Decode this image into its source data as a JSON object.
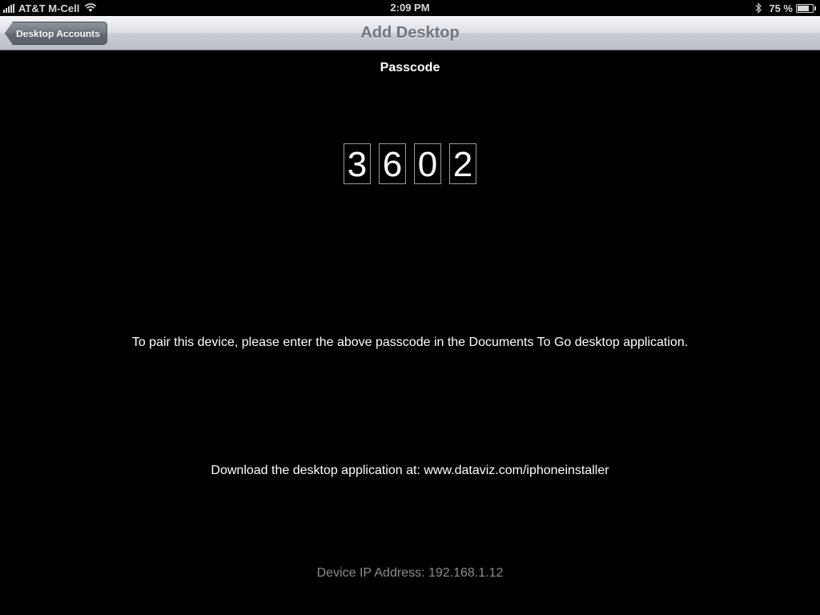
{
  "status_bar": {
    "carrier": "AT&T M-Cell",
    "time": "2:09 PM",
    "battery_percent": "75 %",
    "battery_level": 0.75,
    "icons": [
      "signal-icon",
      "wifi-icon",
      "bluetooth-icon",
      "battery-icon"
    ]
  },
  "nav": {
    "back_label": "Desktop Accounts",
    "title": "Add Desktop"
  },
  "content": {
    "passcode_heading": "Passcode",
    "passcode_digits": [
      "3",
      "6",
      "0",
      "2"
    ],
    "instruction": "To pair this device, please enter the above passcode in the Documents To Go desktop application.",
    "download": "Download the desktop application at: www.dataviz.com/iphoneinstaller",
    "ip_address": "Device IP Address: 192.168.1.12"
  },
  "colors": {
    "background": "#000000",
    "nav_title": "#6e7580",
    "ip_text": "#8c8c8c"
  }
}
